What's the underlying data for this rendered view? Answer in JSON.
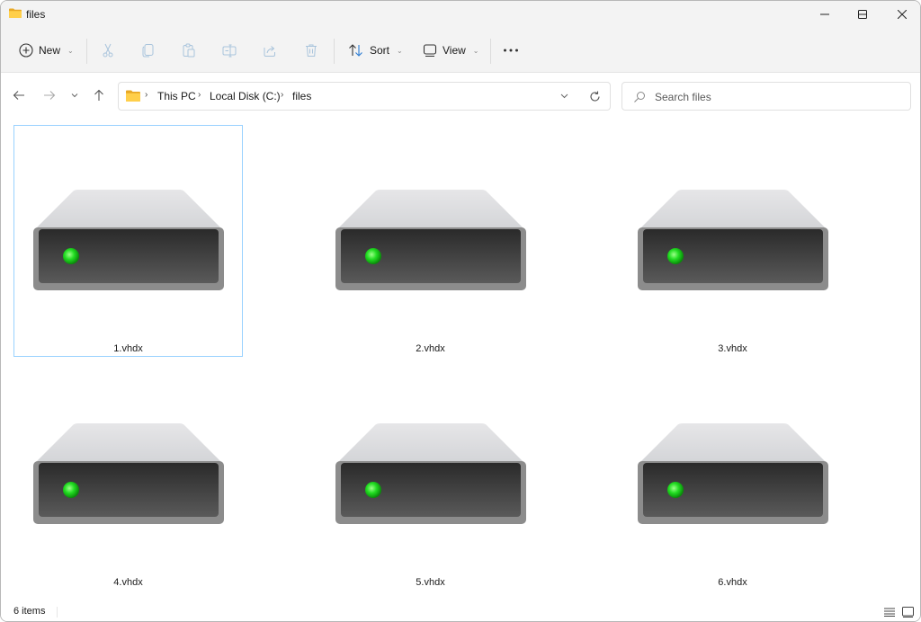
{
  "window": {
    "title": "files",
    "controls": {
      "minimize": "minimize",
      "maximize": "maximize",
      "close": "close"
    }
  },
  "toolbar": {
    "new_label": "New",
    "sort_label": "Sort",
    "view_label": "View",
    "icons": [
      "plus-circle-icon",
      "cut-icon",
      "copy-icon",
      "paste-icon",
      "rename-icon",
      "share-icon",
      "delete-icon",
      "sort-icon",
      "view-icon",
      "more-icon"
    ]
  },
  "navigation": {
    "breadcrumb": [
      "This PC",
      "Local Disk (C:)",
      "files"
    ],
    "separator": "›"
  },
  "search": {
    "placeholder": "Search files",
    "value": ""
  },
  "files": [
    {
      "name": "1.vhdx",
      "icon": "virtual-disk-icon",
      "selected": true
    },
    {
      "name": "2.vhdx",
      "icon": "virtual-disk-icon",
      "selected": false
    },
    {
      "name": "3.vhdx",
      "icon": "virtual-disk-icon",
      "selected": false
    },
    {
      "name": "4.vhdx",
      "icon": "virtual-disk-icon",
      "selected": false
    },
    {
      "name": "5.vhdx",
      "icon": "virtual-disk-icon",
      "selected": false
    },
    {
      "name": "6.vhdx",
      "icon": "virtual-disk-icon",
      "selected": false
    }
  ],
  "status": {
    "item_count": "6 items"
  },
  "colors": {
    "accent": "#0067c0",
    "selection_border": "#99d1ff",
    "led": "#22dd22",
    "folder": "#f7c948"
  }
}
